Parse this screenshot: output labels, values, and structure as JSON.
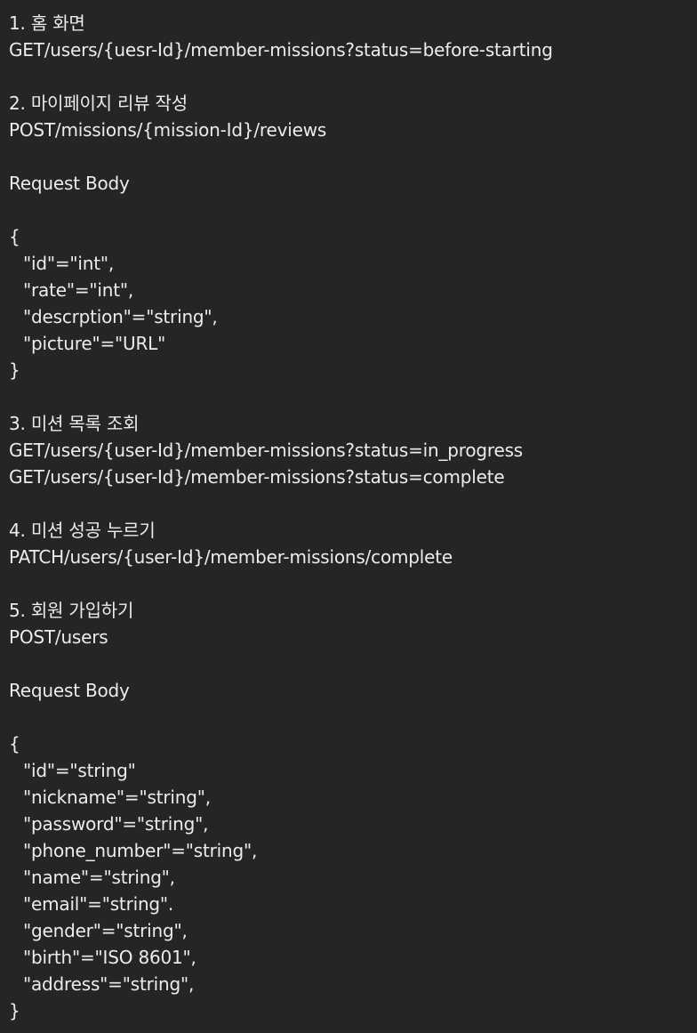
{
  "sections": {
    "s1_title": "1. 홈 화면",
    "s1_ep1": "GET/users/{uesr-Id}/member-missions?status=before-starting",
    "s2_title": "2. 마이페이지 리뷰 작성",
    "s2_ep1": "POST/missions/{mission-Id}/reviews",
    "s2_body_label": "Request Body",
    "s2_open": "{",
    "s2_f1": "\"id\"=\"int\",",
    "s2_f2": "\"rate\"=\"int\",",
    "s2_f3": "\"descrption\"=\"string\",",
    "s2_f4": "\"picture\"=\"URL\"",
    "s2_close": "}",
    "s3_title": "3. 미션 목록 조회",
    "s3_ep1": "GET/users/{user-Id}/member-missions?status=in_progress",
    "s3_ep2": "GET/users/{user-Id}/member-missions?status=complete",
    "s4_title": "4. 미션 성공 누르기",
    "s4_ep1": "PATCH/users/{user-Id}/member-missions/complete",
    "s5_title": "5. 회원 가입하기",
    "s5_ep1": "POST/users",
    "s5_body_label": "Request Body",
    "s5_open": "{",
    "s5_f1": "\"id\"=\"string\"",
    "s5_f2": "\"nickname\"=\"string\",",
    "s5_f3": "\"password\"=\"string\",",
    "s5_f4": "\"phone_number\"=\"string\",",
    "s5_f5": "\"name\"=\"string\",",
    "s5_f6": "\"email\"=\"string\".",
    "s5_f7": "\"gender\"=\"string\",",
    "s5_f8": "\"birth\"=\"ISO 8601\",",
    "s5_f9": "\"address\"=\"string\",",
    "s5_close": "}"
  }
}
